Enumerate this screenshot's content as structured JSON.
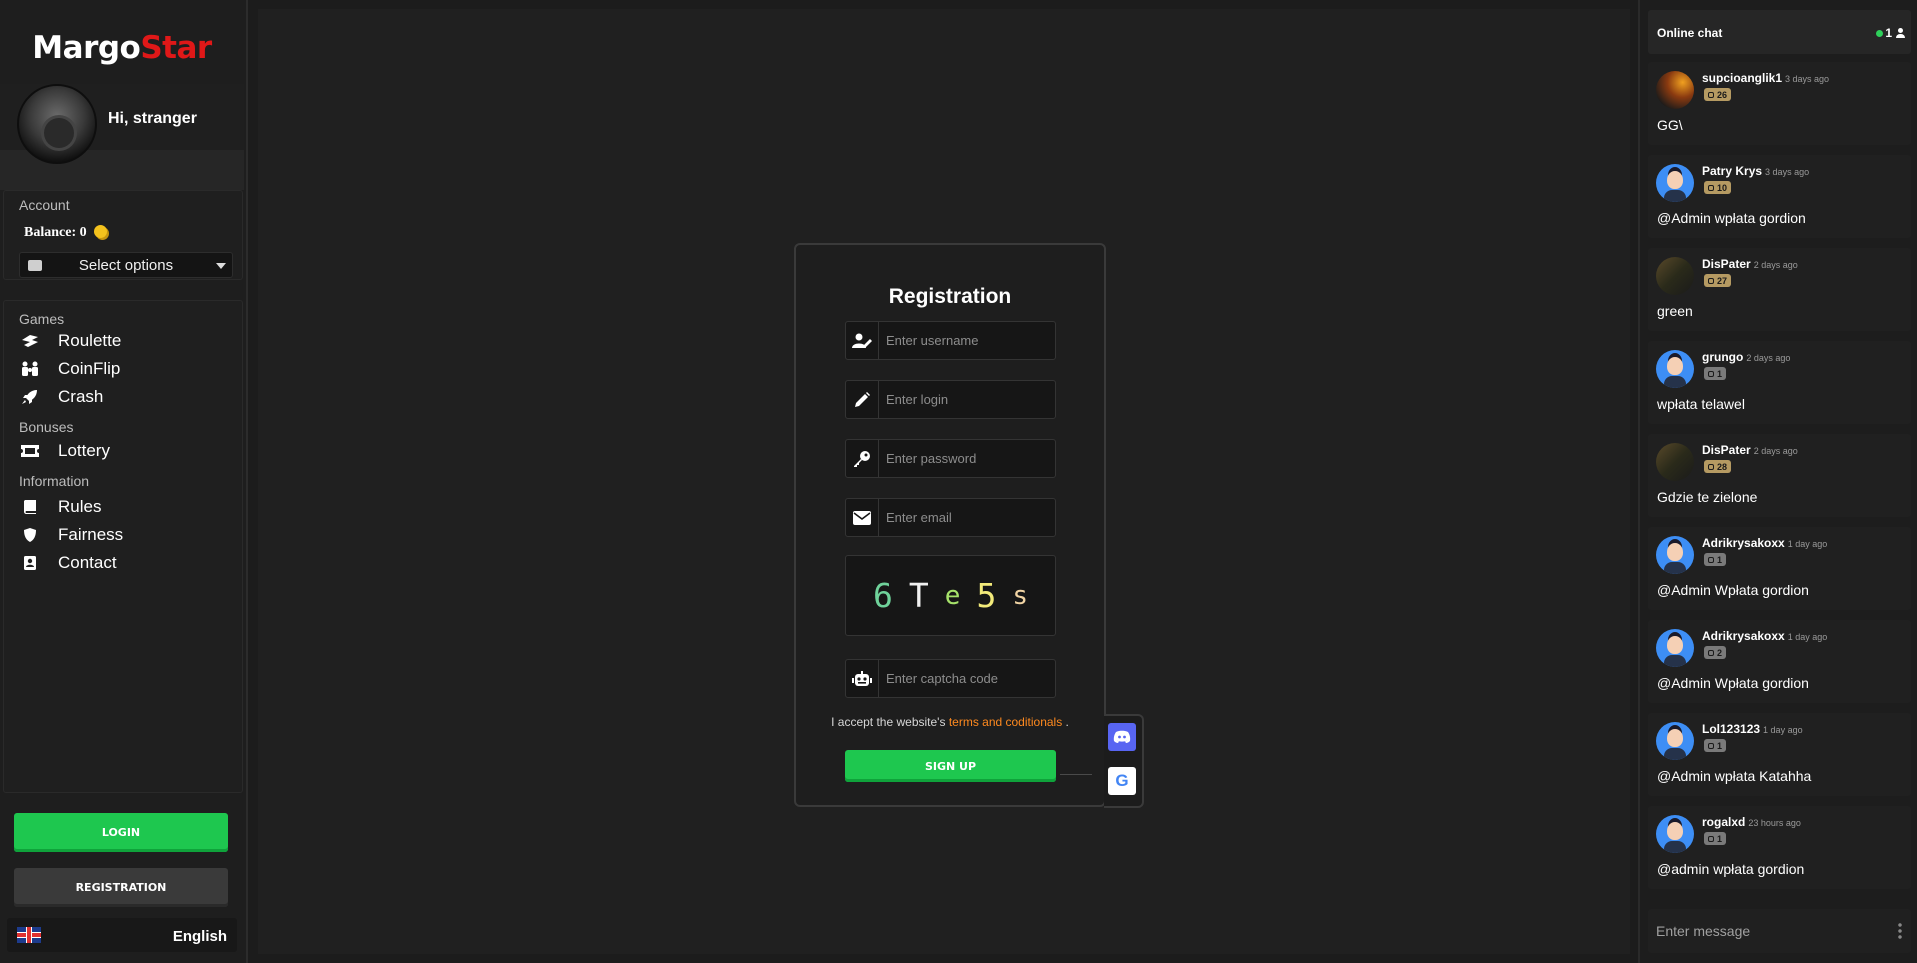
{
  "brand": {
    "part1": "Margo",
    "part2": "Star"
  },
  "profile": {
    "greeting": "Hi, stranger"
  },
  "account": {
    "label": "Account",
    "balance_label": "Balance:",
    "balance_value": "0",
    "select_placeholder": "Select options"
  },
  "menu": {
    "games_label": "Games",
    "games": [
      {
        "label": "Roulette",
        "icon": "roulette-icon"
      },
      {
        "label": "CoinFlip",
        "icon": "coinflip-icon"
      },
      {
        "label": "Crash",
        "icon": "rocket-icon"
      }
    ],
    "bonuses_label": "Bonuses",
    "bonuses": [
      {
        "label": "Lottery",
        "icon": "ticket-icon"
      }
    ],
    "info_label": "Information",
    "info": [
      {
        "label": "Rules",
        "icon": "book-icon"
      },
      {
        "label": "Fairness",
        "icon": "shield-icon"
      },
      {
        "label": "Contact",
        "icon": "address-book-icon"
      }
    ]
  },
  "auth": {
    "login_label": "LOGIN",
    "registration_label": "REGISTRATION"
  },
  "language": {
    "label": "English"
  },
  "registration": {
    "title": "Registration",
    "username_placeholder": "Enter username",
    "login_placeholder": "Enter login",
    "password_placeholder": "Enter password",
    "email_placeholder": "Enter email",
    "captcha_chars": [
      "6",
      "T",
      "e",
      "5",
      "s"
    ],
    "captcha_placeholder": "Enter captcha code",
    "terms_prefix": "I accept the website's",
    "terms_link": "terms and coditionals",
    "terms_suffix": ".",
    "signup_label": "SIGN UP",
    "google_letter": "G"
  },
  "chat": {
    "title": "Online chat",
    "online_count": "1",
    "input_placeholder": "Enter message",
    "messages": [
      {
        "user": "supcioanglik1",
        "time": "3 days ago",
        "level": "26",
        "text": "GG\\"
      },
      {
        "user": "Patry Krys",
        "time": "3 days ago",
        "level": "10",
        "text": "@Admin wpłata gordion"
      },
      {
        "user": "DisPater",
        "time": "2 days ago",
        "level": "27",
        "text": "green"
      },
      {
        "user": "grungo",
        "time": "2 days ago",
        "level": "1",
        "text": "wpłata telawel"
      },
      {
        "user": "DisPater",
        "time": "2 days ago",
        "level": "28",
        "text": "Gdzie te zielone"
      },
      {
        "user": "Adrikrysakoxx",
        "time": "1 day ago",
        "level": "1",
        "text": "@Admin Wpłata gordion"
      },
      {
        "user": "Adrikrysakoxx",
        "time": "1 day ago",
        "level": "2",
        "text": "@Admin Wpłata gordion"
      },
      {
        "user": "Lol123123",
        "time": "1 day ago",
        "level": "1",
        "text": "@Admin wpłata Katahha"
      },
      {
        "user": "rogalxd",
        "time": "23 hours ago",
        "level": "1",
        "text": "@admin wpłata gordion"
      }
    ]
  },
  "colors": {
    "accent_green": "#1ec74f",
    "brand_red": "#e01818",
    "link_orange": "#ff8a1f",
    "discord": "#5865f2"
  }
}
